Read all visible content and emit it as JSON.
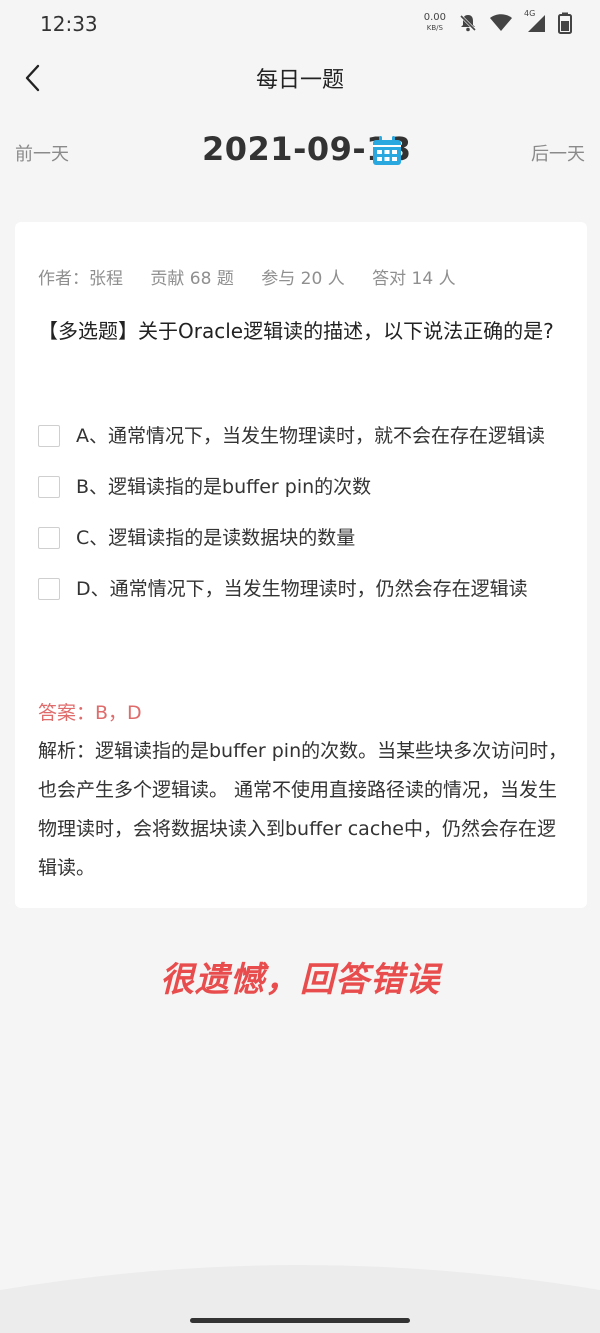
{
  "status": {
    "time": "12:33",
    "net_speed": "0.00",
    "net_unit": "KB/S",
    "network_type": "4G"
  },
  "header": {
    "title": "每日一题"
  },
  "date_nav": {
    "prev_label": "前一天",
    "date": "2021-09-13",
    "next_label": "后一天"
  },
  "question": {
    "author": "作者：张程",
    "contributed": "贡献 68 题",
    "participants": "参与 20 人",
    "correct_count": "答对 14 人",
    "text": "【多选题】关于Oracle逻辑读的描述，以下说法正确的是?",
    "options": [
      "A、通常情况下，当发生物理读时，就不会在存在逻辑读",
      "B、逻辑读指的是buffer pin的次数",
      "C、逻辑读指的是读数据块的数量",
      "D、通常情况下，当发生物理读时，仍然会存在逻辑读"
    ],
    "answer": "答案：B，D",
    "analysis": "解析：逻辑读指的是buffer pin的次数。当某些块多次访问时，也会产生多个逻辑读。 通常不使用直接路径读的情况，当发生物理读时，会将数据块读入到buffer cache中，仍然会存在逻辑读。"
  },
  "result_text": "很遗憾，回答错误",
  "colors": {
    "accent": "#e84c4c",
    "answer": "#e06b6b",
    "calendar": "#29a8e0"
  }
}
